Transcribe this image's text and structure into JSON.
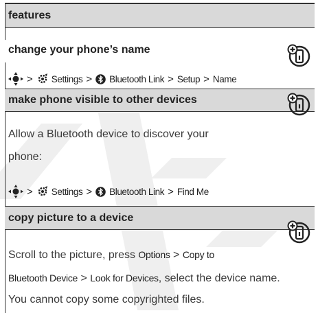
{
  "header": {
    "title": "features"
  },
  "sections": [
    {
      "title": "change your phone’s name",
      "path": [
        "Settings",
        "Bluetooth Link",
        "Setup",
        "Name"
      ]
    },
    {
      "title": "make phone visible to other devices",
      "desc_line1": "Allow a Bluetooth device to discover your",
      "desc_line2": "phone:",
      "path": [
        "Settings",
        "Bluetooth Link",
        "Find Me"
      ]
    },
    {
      "title": "copy picture to a device",
      "line1_a": "Scroll to the picture, press ",
      "line1_b": "Options",
      "line1_c": " > ",
      "line1_d": "Copy to",
      "line2_a": "Bluetooth Device",
      "line2_b": " > ",
      "line2_c": "Look for Devices",
      "line2_d": ", select the device name.",
      "line3": "You cannot copy some copyrighted files."
    }
  ],
  "separator": ">",
  "watermark": {
    "color": "#e8e8e8"
  }
}
